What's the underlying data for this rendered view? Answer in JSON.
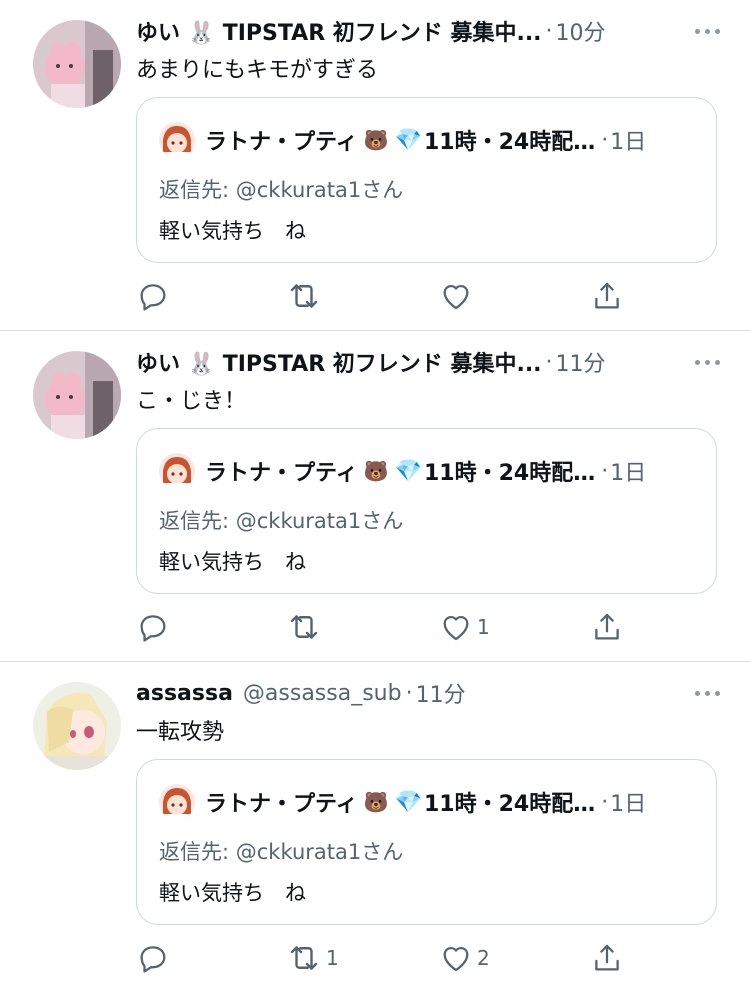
{
  "quoted": {
    "name": "ラトナ・プティ",
    "bear": "🐻",
    "gem": "💎",
    "bio_fragment": "11時・24時配…",
    "time": "1日",
    "reply_to": "返信先: @ckkurata1さん",
    "text": "軽い気持ち　ね"
  },
  "tweets": [
    {
      "name": "ゆい 🐰 TIPSTAR 初フレンド 募集中...",
      "handle": "",
      "time": "10分",
      "text": "あまりにもキモがすぎる",
      "reply_count": "",
      "retweet_count": "",
      "like_count": ""
    },
    {
      "name": "ゆい 🐰 TIPSTAR 初フレンド 募集中...",
      "handle": "",
      "time": "11分",
      "text": "こ・じき！",
      "reply_count": "",
      "retweet_count": "",
      "like_count": "1"
    },
    {
      "name": "assassa",
      "handle": "@assassa_sub",
      "time": "11分",
      "text": "一転攻勢",
      "reply_count": "",
      "retweet_count": "1",
      "like_count": "2"
    }
  ],
  "icons": {
    "reply": "reply-icon",
    "retweet": "retweet-icon",
    "like": "like-icon",
    "share": "share-icon",
    "more": "more-icon"
  },
  "colors": {
    "text": "#0f1419",
    "secondary": "#536471",
    "divider": "#d9dde1",
    "quote_border": "#cfd9de"
  }
}
